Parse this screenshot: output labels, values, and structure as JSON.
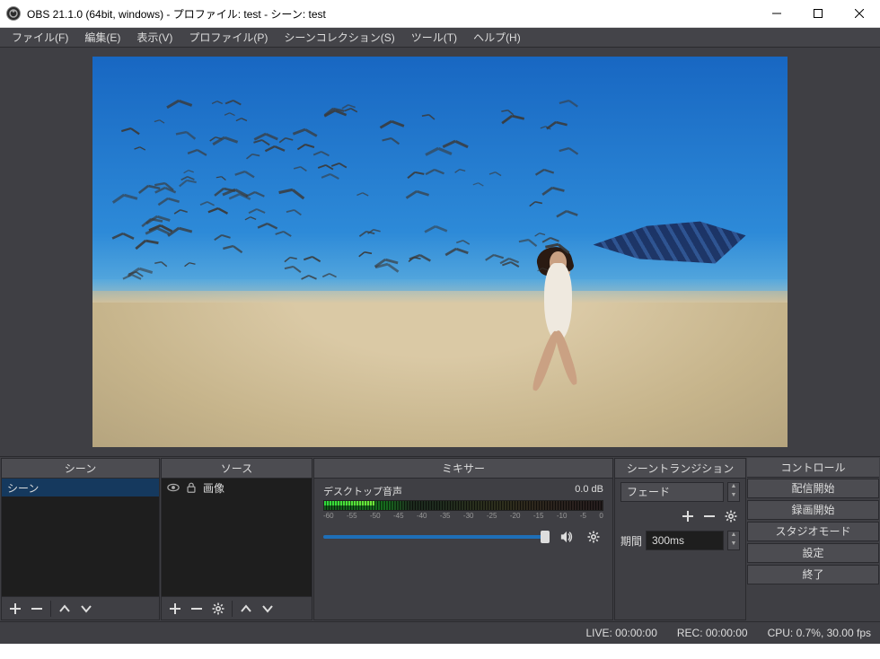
{
  "window": {
    "title": "OBS 21.1.0 (64bit, windows) - プロファイル: test - シーン: test"
  },
  "menu": {
    "file": "ファイル(F)",
    "edit": "編集(E)",
    "view": "表示(V)",
    "profile": "プロファイル(P)",
    "scenecol": "シーンコレクション(S)",
    "tools": "ツール(T)",
    "help": "ヘルプ(H)"
  },
  "panels": {
    "scenes": {
      "title": "シーン",
      "items": [
        "シーン"
      ]
    },
    "sources": {
      "title": "ソース",
      "items": [
        {
          "label": "画像",
          "visible": true,
          "locked": true
        }
      ]
    },
    "mixer": {
      "title": "ミキサー",
      "strip": {
        "name": "デスクトップ音声",
        "db": "0.0 dB",
        "ticks": [
          "-60",
          "-55",
          "-50",
          "-45",
          "-40",
          "-35",
          "-30",
          "-25",
          "-20",
          "-15",
          "-10",
          "-5",
          "0"
        ]
      }
    },
    "transitions": {
      "title": "シーントランジション",
      "selected": "フェード",
      "duration_label": "期間",
      "duration_value": "300ms"
    },
    "controls": {
      "title": "コントロール",
      "buttons": {
        "stream": "配信開始",
        "record": "録画開始",
        "studio": "スタジオモード",
        "settings": "設定",
        "exit": "終了"
      }
    }
  },
  "status": {
    "live": "LIVE: 00:00:00",
    "rec": "REC: 00:00:00",
    "cpu": "CPU: 0.7%, 30.00 fps"
  }
}
